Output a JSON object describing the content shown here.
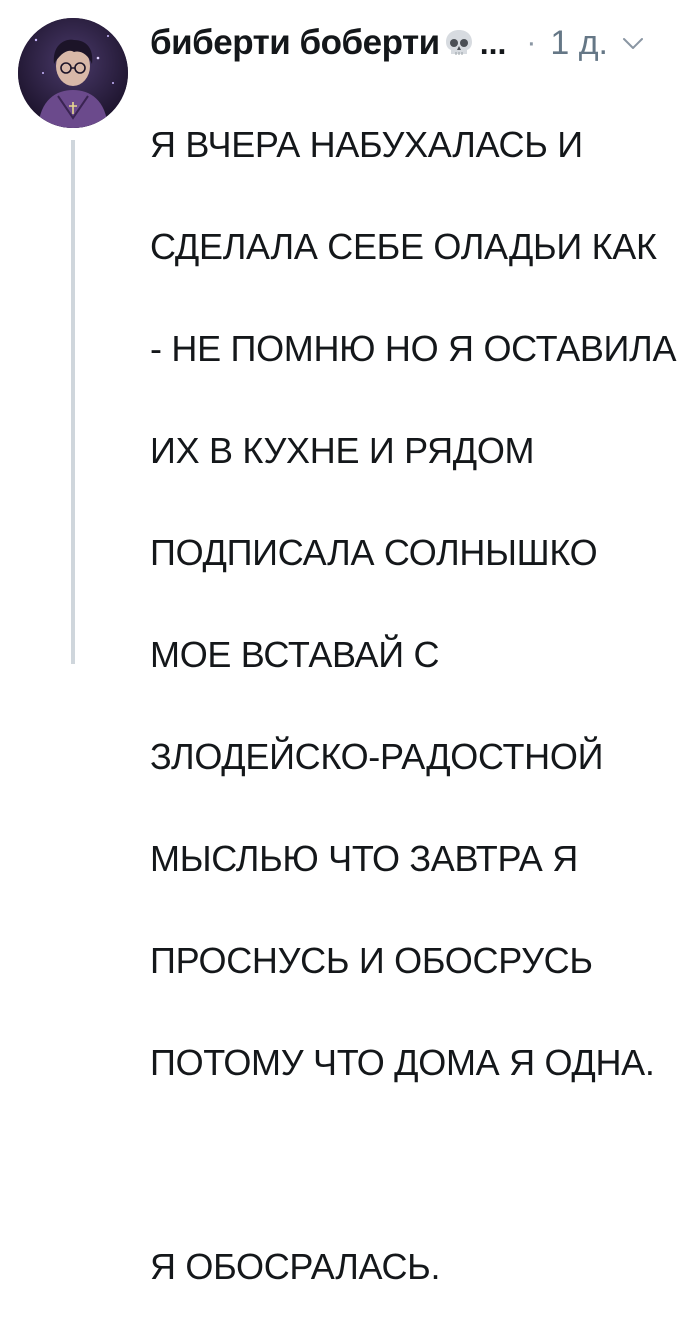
{
  "tweet": {
    "author_name": "биберти боберти",
    "name_emoji": "skull-emoji-icon",
    "name_truncation": "...",
    "separator": "·",
    "timestamp": "1 д.",
    "menu_icon": "chevron-down-icon",
    "avatar_icon": "user-avatar",
    "text_lines": [
      "Я ВЧЕРА НАБУХАЛАСЬ И",
      "СДЕЛАЛА СЕБЕ ОЛАДЬИ КАК",
      "- НЕ ПОМНЮ НО Я ОСТАВИЛА",
      "ИХ В КУХНЕ И РЯДОМ",
      "ПОДПИСАЛА СОЛНЫШКО",
      "МОЕ ВСТАВАЙ С",
      "ЗЛОДЕЙСКО-РАДОСТНОЙ",
      "МЫСЛЬЮ ЧТО ЗАВТРА Я",
      "ПРОСНУСЬ И ОБОСРУСЬ",
      "ПОТОМУ ЧТО ДОМА Я ОДНА."
    ],
    "text_final": "Я ОБОСРАЛАСЬ."
  },
  "colors": {
    "text": "#14171a",
    "secondary": "#657786",
    "thread_line": "#cfd6dc"
  }
}
